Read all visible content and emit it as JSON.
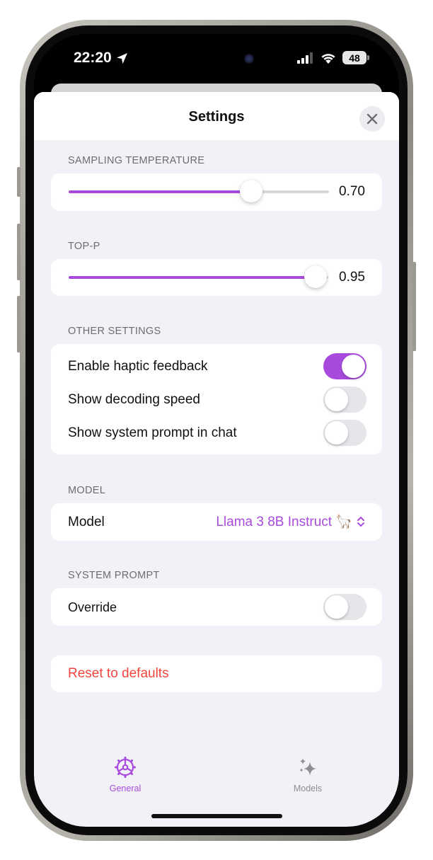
{
  "status_bar": {
    "time": "22:20",
    "battery": "48"
  },
  "sheet": {
    "title": "Settings"
  },
  "sampling_temperature": {
    "label": "SAMPLING TEMPERATURE",
    "value": 0.7,
    "value_text": "0.70"
  },
  "top_p": {
    "label": "TOP-P",
    "value": 0.95,
    "value_text": "0.95"
  },
  "other_settings": {
    "label": "OTHER SETTINGS",
    "rows": [
      {
        "label": "Enable haptic feedback",
        "on": true
      },
      {
        "label": "Show decoding speed",
        "on": false
      },
      {
        "label": "Show system prompt in chat",
        "on": false
      }
    ]
  },
  "model_section": {
    "label": "MODEL",
    "row_label": "Model",
    "value": "Llama 3 8B Instruct 🦙"
  },
  "system_prompt": {
    "label": "SYSTEM PROMPT",
    "row_label": "Override",
    "on": false
  },
  "reset": {
    "label": "Reset to defaults"
  },
  "tabs": [
    {
      "label": "General",
      "icon": "settings-gear-icon",
      "active": true
    },
    {
      "label": "Models",
      "icon": "sparkles-icon",
      "active": false
    }
  ],
  "colors": {
    "accent": "#a84bdc",
    "destructive": "#f0463d",
    "background": "#f2f1f7",
    "inactive": "#8e8e93"
  }
}
